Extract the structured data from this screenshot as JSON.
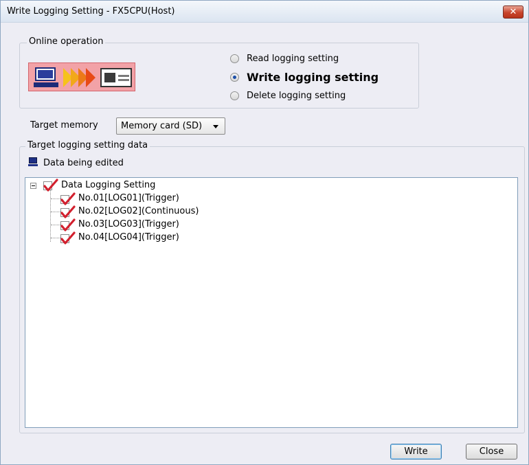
{
  "window": {
    "title": "Write Logging Setting - FX5CPU(Host)",
    "close_glyph": "✕"
  },
  "online_operation": {
    "legend": "Online operation",
    "options": [
      {
        "label": "Read logging setting",
        "selected": false
      },
      {
        "label": "Write logging setting",
        "selected": true
      },
      {
        "label": "Delete logging setting",
        "selected": false
      }
    ]
  },
  "target_memory": {
    "label": "Target memory",
    "value": "Memory card (SD)"
  },
  "target_data": {
    "legend": "Target logging setting data",
    "source_label": "Data being edited",
    "tree": {
      "root": {
        "label": "Data Logging Setting",
        "checked": true
      },
      "children": [
        {
          "label": "No.01[LOG01](Trigger)",
          "checked": true
        },
        {
          "label": "No.02[LOG02](Continuous)",
          "checked": true
        },
        {
          "label": "No.03[LOG03](Trigger)",
          "checked": true
        },
        {
          "label": "No.04[LOG04](Trigger)",
          "checked": true
        }
      ]
    }
  },
  "buttons": {
    "write": "Write",
    "close": "Close"
  },
  "colors": {
    "check_mark": "#d2202e",
    "dialog_bg": "#ededf4",
    "graphic_bg": "#f2a2a7"
  }
}
